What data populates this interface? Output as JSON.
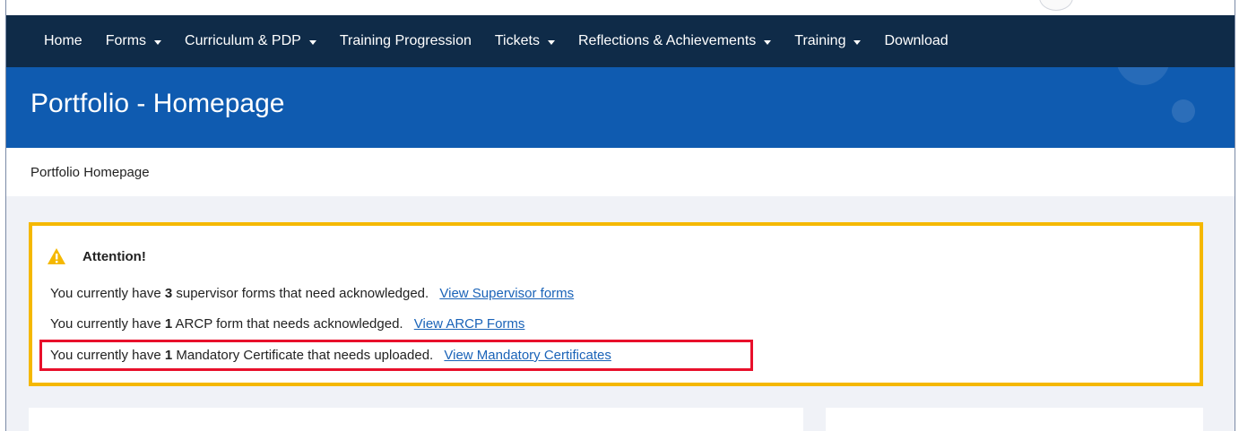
{
  "nav": {
    "items": [
      {
        "label": "Home",
        "dropdown": false
      },
      {
        "label": "Forms",
        "dropdown": true
      },
      {
        "label": "Curriculum & PDP",
        "dropdown": true
      },
      {
        "label": "Training Progression",
        "dropdown": false
      },
      {
        "label": "Tickets",
        "dropdown": true
      },
      {
        "label": "Reflections & Achievements",
        "dropdown": true
      },
      {
        "label": "Training",
        "dropdown": true
      },
      {
        "label": "Download",
        "dropdown": false
      }
    ]
  },
  "banner": {
    "title": "Portfolio - Homepage"
  },
  "breadcrumb": {
    "label": "Portfolio Homepage"
  },
  "alert": {
    "heading": "Attention!",
    "lines": [
      {
        "prefix": "You currently have ",
        "count": "3",
        "suffix": " supervisor forms that need acknowledged.",
        "link": "View Supervisor forms"
      },
      {
        "prefix": "You currently have ",
        "count": "1",
        "suffix": " ARCP form that needs acknowledged.",
        "link": "View ARCP Forms"
      },
      {
        "prefix": "You currently have ",
        "count": "1",
        "suffix": " Mandatory Certificate that needs uploaded.",
        "link": "View Mandatory Certificates"
      }
    ]
  },
  "colors": {
    "navbar": "#0f2b48",
    "banner": "#0f5bb0",
    "alert_border": "#f5b800",
    "highlight_border": "#e8102b",
    "link": "#1a63b8"
  }
}
